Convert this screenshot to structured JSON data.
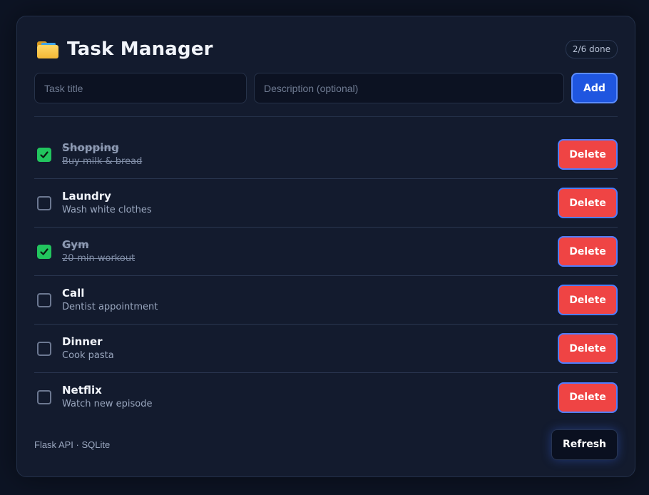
{
  "header": {
    "icon": "folder-icon",
    "title": "Task Manager",
    "done_badge": "2/6 done"
  },
  "form": {
    "title_placeholder": "Task title",
    "title_value": "",
    "description_placeholder": "Description (optional)",
    "description_value": "",
    "add_label": "Add"
  },
  "tasks": [
    {
      "title": "Shopping",
      "description": "Buy milk & bread",
      "done": true,
      "delete_label": "Delete"
    },
    {
      "title": "Laundry",
      "description": "Wash white clothes",
      "done": false,
      "delete_label": "Delete"
    },
    {
      "title": "Gym",
      "description": "20-min workout",
      "done": true,
      "delete_label": "Delete"
    },
    {
      "title": "Call",
      "description": "Dentist appointment",
      "done": false,
      "delete_label": "Delete"
    },
    {
      "title": "Dinner",
      "description": "Cook pasta",
      "done": false,
      "delete_label": "Delete"
    },
    {
      "title": "Netflix",
      "description": "Watch new episode",
      "done": false,
      "delete_label": "Delete"
    }
  ],
  "footer": {
    "note": "Flask API · SQLite",
    "refresh_label": "Refresh"
  },
  "colors": {
    "background": "#0d1424",
    "card": "#131b2e",
    "accent": "#1f56e0",
    "danger": "#ef4444",
    "success": "#22c55e"
  }
}
